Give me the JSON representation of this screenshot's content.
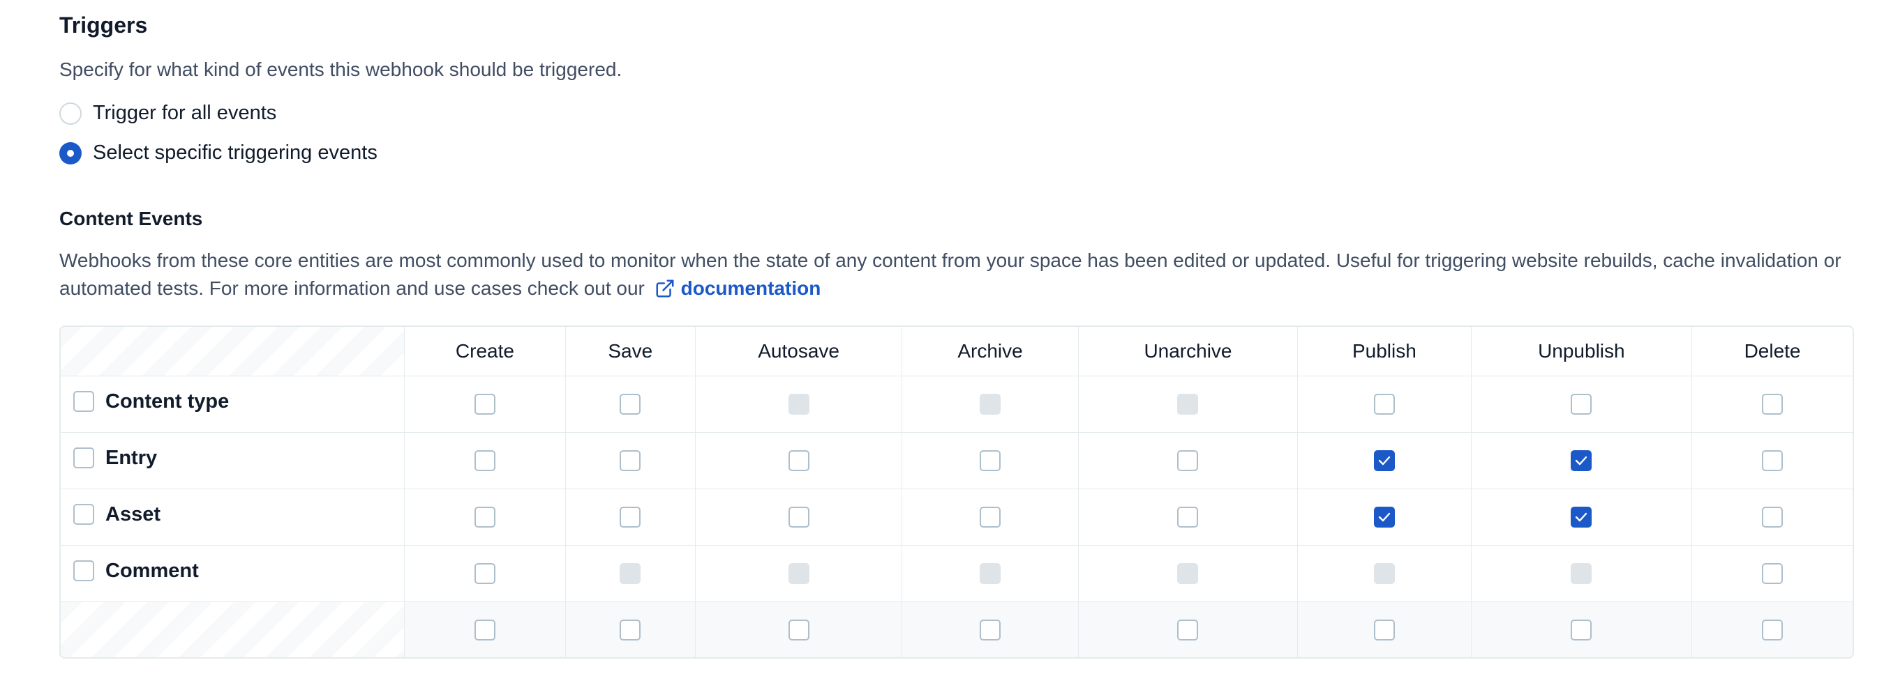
{
  "triggers": {
    "title": "Triggers",
    "description": "Specify for what kind of events this webhook should be triggered.",
    "options": [
      {
        "label": "Trigger for all events",
        "selected": false
      },
      {
        "label": "Select specific triggering events",
        "selected": true
      }
    ]
  },
  "content_events": {
    "title": "Content Events",
    "description": "Webhooks from these core entities are most commonly used to monitor when the state of any content from your space has been edited or updated. Useful for triggering website rebuilds, cache invalidation or automated tests. For more information and use cases check out our",
    "link_label": "documentation",
    "link_icon": "external-link-icon",
    "columns": [
      "Create",
      "Save",
      "Autosave",
      "Archive",
      "Unarchive",
      "Publish",
      "Unpublish",
      "Delete"
    ],
    "rows": [
      {
        "label": "Content type",
        "cells": [
          "unchecked",
          "unchecked",
          "disabled",
          "disabled",
          "disabled",
          "unchecked",
          "unchecked",
          "unchecked"
        ]
      },
      {
        "label": "Entry",
        "cells": [
          "unchecked",
          "unchecked",
          "unchecked",
          "unchecked",
          "unchecked",
          "checked",
          "checked",
          "unchecked"
        ]
      },
      {
        "label": "Asset",
        "cells": [
          "unchecked",
          "unchecked",
          "unchecked",
          "unchecked",
          "unchecked",
          "checked",
          "checked",
          "unchecked"
        ]
      },
      {
        "label": "Comment",
        "cells": [
          "unchecked",
          "disabled",
          "disabled",
          "disabled",
          "disabled",
          "disabled",
          "disabled",
          "unchecked"
        ]
      }
    ],
    "footer_cells": [
      "unchecked",
      "unchecked",
      "unchecked",
      "unchecked",
      "unchecked",
      "unchecked",
      "unchecked",
      "unchecked"
    ]
  },
  "colors": {
    "accent": "#1b58c8",
    "border": "#e5ebed",
    "disabled": "#dfe4e8"
  }
}
